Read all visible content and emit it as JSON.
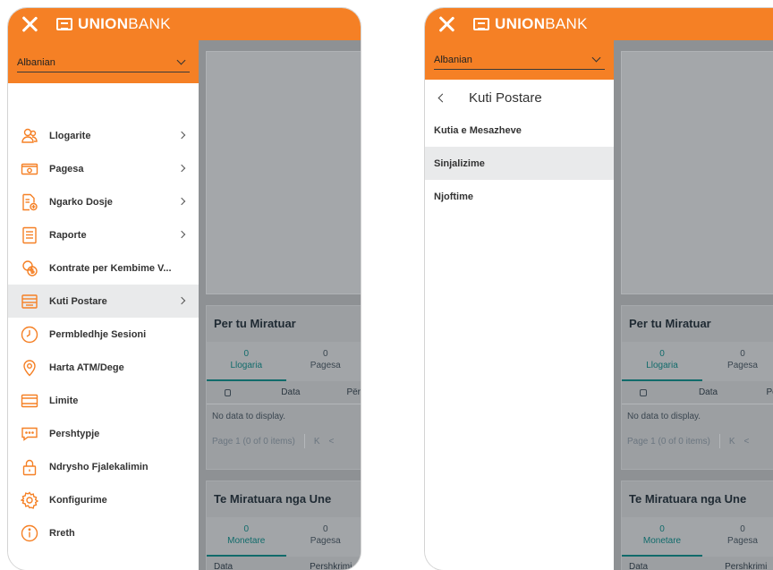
{
  "brand": {
    "logo_bold": "UNION",
    "logo_light": "BANK",
    "accent": "#f58025"
  },
  "language": {
    "selected": "Albanian"
  },
  "menu": {
    "items": [
      {
        "label": "Llogarite",
        "icon": "accounts-icon",
        "has_submenu": true
      },
      {
        "label": "Pagesa",
        "icon": "payment-icon",
        "has_submenu": true
      },
      {
        "label": "Ngarko Dosje",
        "icon": "upload-file-icon",
        "has_submenu": true
      },
      {
        "label": "Raporte",
        "icon": "report-icon",
        "has_submenu": true
      },
      {
        "label": "Kontrate per Kembime V...",
        "icon": "currency-exchange-icon",
        "has_submenu": false
      },
      {
        "label": "Kuti Postare",
        "icon": "mailbox-icon",
        "has_submenu": true,
        "active": true
      },
      {
        "label": "Permbledhje Sesioni",
        "icon": "clock-icon",
        "has_submenu": false
      },
      {
        "label": "Harta ATM/Dege",
        "icon": "location-pin-icon",
        "has_submenu": false
      },
      {
        "label": "Limite",
        "icon": "limits-icon",
        "has_submenu": false
      },
      {
        "label": "Pershtypje",
        "icon": "feedback-icon",
        "has_submenu": false
      },
      {
        "label": "Ndrysho Fjalekalimin",
        "icon": "lock-icon",
        "has_submenu": false
      },
      {
        "label": "Konfigurime",
        "icon": "gear-icon",
        "has_submenu": false
      },
      {
        "label": "Rreth",
        "icon": "info-icon",
        "has_submenu": false
      }
    ]
  },
  "submenu": {
    "title": "Kuti Postare",
    "items": [
      {
        "label": "Kutia e Mesazheve"
      },
      {
        "label": "Sinjalizime",
        "active": true
      },
      {
        "label": "Njoftime"
      }
    ]
  },
  "background": {
    "pending": {
      "title": "Per tu Miratuar",
      "tabs": [
        {
          "count": "0",
          "label": "Llogaria"
        },
        {
          "count": "0",
          "label": "Pagesa"
        }
      ],
      "columns": [
        "Data",
        "Përs"
      ],
      "no_data": "No data to display.",
      "pager_page_label": "Page",
      "pager_page": "1",
      "pager_info": "(0 of 0 items)",
      "pager_first": "K",
      "pager_prev": "<"
    },
    "approved": {
      "title": "Te Miratuara nga Une",
      "tabs": [
        {
          "count": "0",
          "label": "Monetare"
        },
        {
          "count": "0",
          "label": "Pagesa"
        }
      ],
      "columns": [
        "Data",
        "Pershkrimi"
      ]
    }
  }
}
